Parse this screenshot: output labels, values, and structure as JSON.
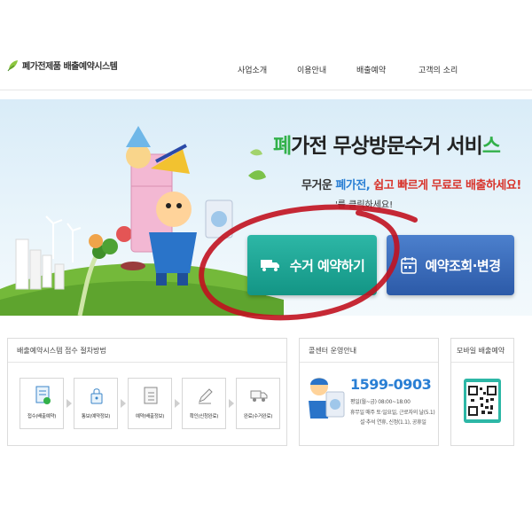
{
  "header": {
    "logo_text": "폐가전제품 배출예약시스템",
    "nav": [
      "사업소개",
      "이용안내",
      "배출예약",
      "고객의 소리"
    ]
  },
  "hero": {
    "title_accent_start": "폐",
    "title_middle": "가전 무상방문수거 서비",
    "title_accent_end": "스",
    "sub_part1": "무거운 ",
    "sub_part2": "폐가전, ",
    "sub_part3": "쉽고 빠르게 무료로",
    "sub_part4": " 배출하세요!",
    "note": "'를 클릭하세요!",
    "btn_reserve": "수거 예약하기",
    "btn_check": "예약조회·변경"
  },
  "procedure": {
    "title": "배출예약시스템 접수 절차방법",
    "steps": [
      "접수(배출예약)",
      "통보(예약정보)",
      "예약(배출정보)",
      "확인(신청완료)",
      "완료(수거완료)"
    ]
  },
  "callcenter": {
    "title": "콜센터 운영안내",
    "phone": "1599-0903",
    "line1": "평일(월~금) 08:00~18:00",
    "line2_label": "휴무일",
    "line2_text": "매주 토·일요일, 근로자의 날(5.1)",
    "line3": "설·추석 연휴, 신정(1.1), 공휴일"
  },
  "mobile": {
    "title": "모바일 배출예약"
  },
  "colors": {
    "green": "#32b14a",
    "teal_button": "#1fa594",
    "blue_button": "#3a6fbf",
    "phone_blue": "#2a7fd4",
    "red_highlight": "#d8342c",
    "annotation_circle": "#c1121f"
  }
}
